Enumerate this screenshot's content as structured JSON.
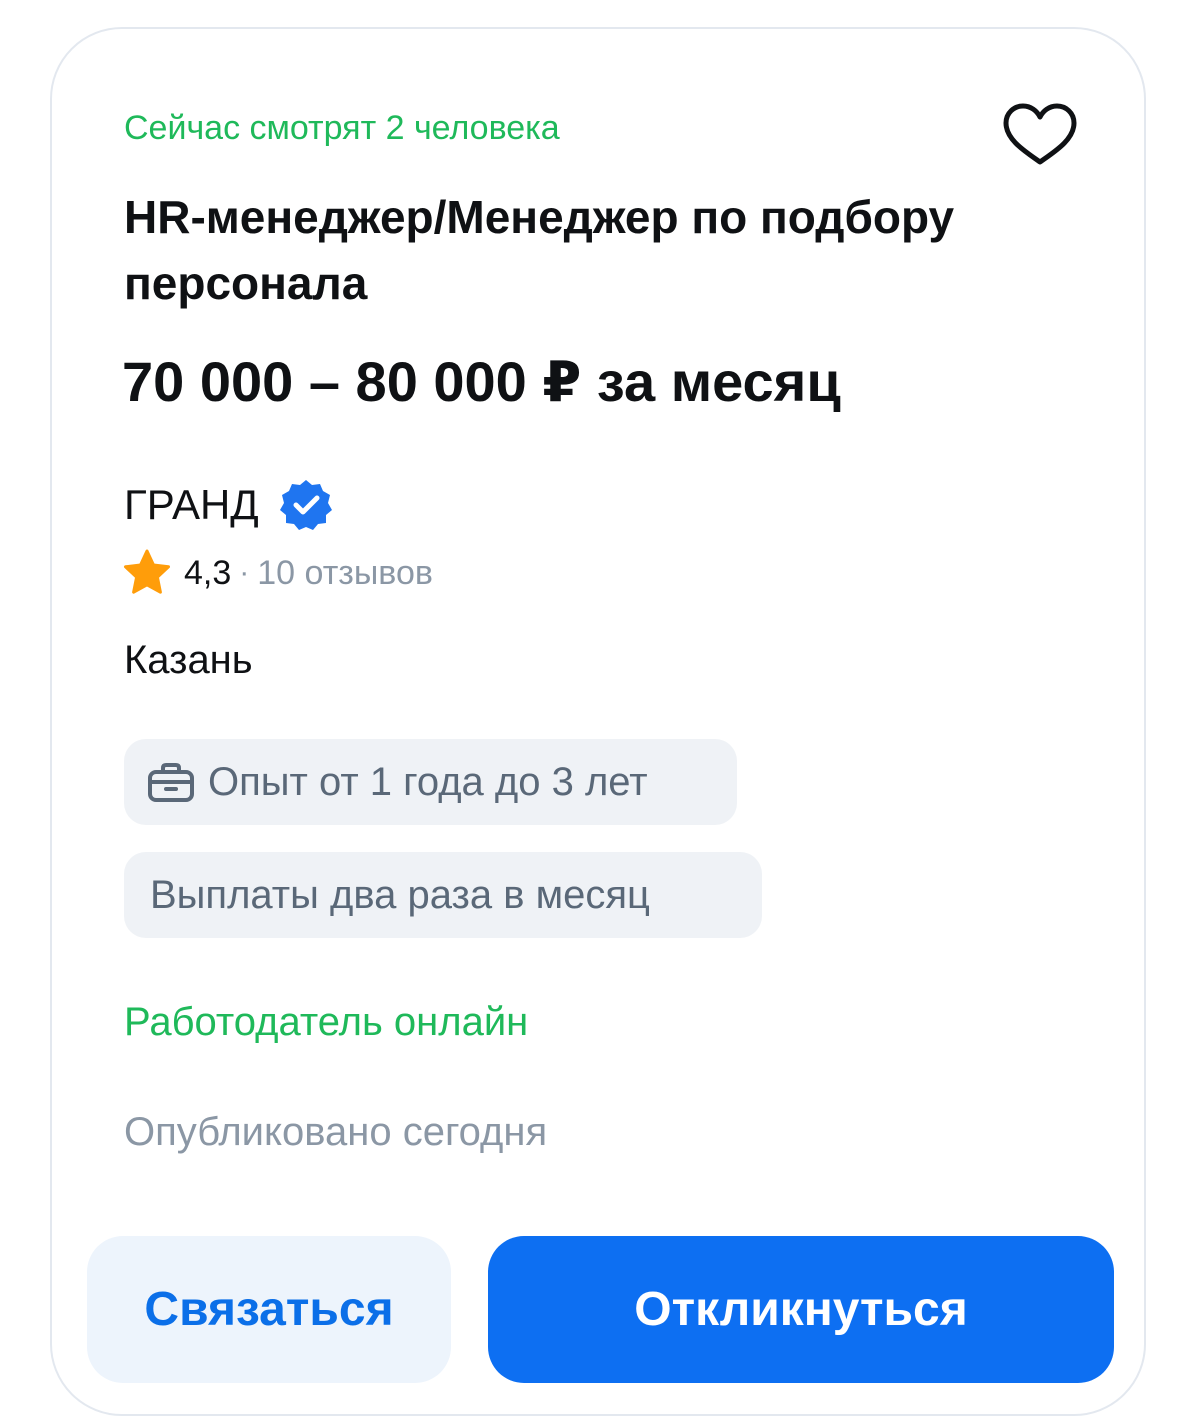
{
  "vacancy": {
    "viewers_text": "Сейчас смотрят 2 человека",
    "title": "HR-менеджер/Менеджер по подбору персонала",
    "salary": "70 000 – 80 000 ₽ за месяц",
    "company": {
      "name": "ГРАНД",
      "verified": true,
      "rating": "4,3",
      "separator": "·",
      "reviews": "10 отзывов"
    },
    "city": "Казань",
    "tags": {
      "experience": "Опыт от 1 года до 3 лет",
      "payments": "Выплаты два раза в месяц"
    },
    "employer_status": "Работодатель онлайн",
    "published": "Опубликовано сегодня"
  },
  "actions": {
    "contact_label": "Связаться",
    "apply_label": "Откликнуться"
  },
  "icons": {
    "favorite": "heart-outline-icon",
    "verified": "verified-badge-icon",
    "rating": "star-icon",
    "experience": "briefcase-icon"
  },
  "colors": {
    "accent_green": "#1fb95a",
    "primary_blue": "#0d6ff2",
    "verified_blue": "#1f75f0",
    "star_orange": "#ff9d0a",
    "muted_gray": "#8b97a5",
    "chip_bg": "#eff2f6",
    "secondary_button_bg": "#edf4fc"
  }
}
